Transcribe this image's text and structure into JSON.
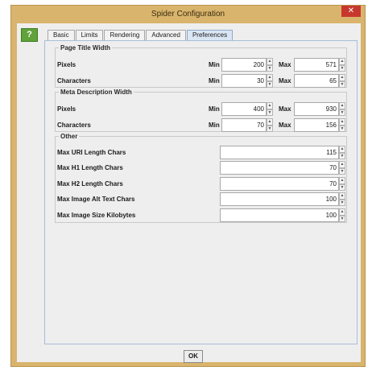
{
  "window": {
    "title": "Spider Configuration",
    "close_symbol": "✕"
  },
  "help": {
    "symbol": "?"
  },
  "tabs": [
    {
      "label": "Basic"
    },
    {
      "label": "Limits"
    },
    {
      "label": "Rendering"
    },
    {
      "label": "Advanced"
    },
    {
      "label": "Preferences",
      "active": true
    }
  ],
  "page_title_width": {
    "legend": "Page Title Width",
    "pixels": {
      "label": "Pixels",
      "min_label": "Min",
      "min": "200",
      "max_label": "Max",
      "max": "571"
    },
    "characters": {
      "label": "Characters",
      "min_label": "Min",
      "min": "30",
      "max_label": "Max",
      "max": "65"
    }
  },
  "meta_description_width": {
    "legend": "Meta Description Width",
    "pixels": {
      "label": "Pixels",
      "min_label": "Min",
      "min": "400",
      "max_label": "Max",
      "max": "930"
    },
    "characters": {
      "label": "Characters",
      "min_label": "Min",
      "min": "70",
      "max_label": "Max",
      "max": "156"
    }
  },
  "other": {
    "legend": "Other",
    "rows": [
      {
        "label": "Max URI Length Chars",
        "value": "115"
      },
      {
        "label": "Max H1 Length Chars",
        "value": "70"
      },
      {
        "label": "Max H2 Length Chars",
        "value": "70"
      },
      {
        "label": "Max Image Alt Text Chars",
        "value": "100"
      },
      {
        "label": "Max Image Size Kilobytes",
        "value": "100"
      }
    ]
  },
  "spinner_arrows": {
    "up": "▲",
    "down": "▼"
  },
  "ok_label": "OK",
  "colors": {
    "frame": "#d9b46c",
    "close": "#c8372d",
    "help": "#5fa33a",
    "active_tab": "#dbe6f4"
  }
}
